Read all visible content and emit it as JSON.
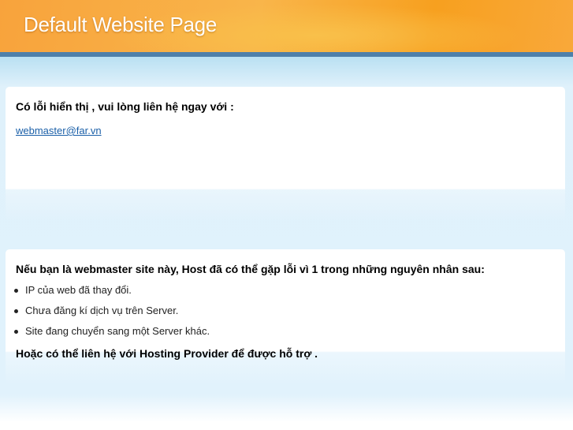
{
  "header": {
    "title": "Default Website Page"
  },
  "box1": {
    "message": "Có lỗi hiển thị , vui lòng liên hệ ngay với :",
    "email": "webmaster@far.vn"
  },
  "box2": {
    "intro": "Nếu bạn là webmaster site này, Host đã có thể gặp lỗi vì 1 trong những nguyên nhân sau:",
    "reasons": [
      "IP của web đã thay đổi.",
      "Chưa đăng kí dịch vụ trên Server.",
      "Site đang chuyển sang một Server khác."
    ],
    "footer": "Hoặc có thể liên hệ với Hosting Provider để được hỗ trợ ."
  }
}
